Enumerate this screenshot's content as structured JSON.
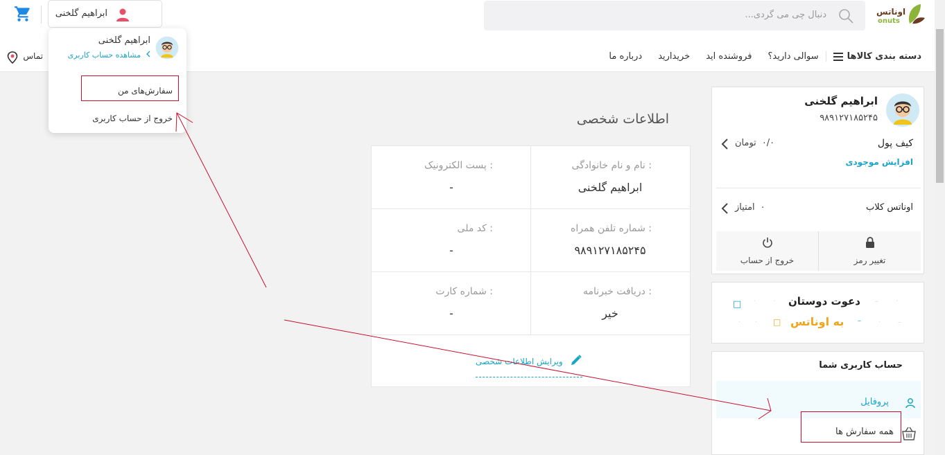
{
  "header": {
    "logo_text": "اوناتس",
    "logo_sub": "onuts",
    "search_placeholder": "دنبال چی می گردی...",
    "user_name": "ابراهیم گلخنی",
    "nav": [
      "دسته بندی کالاها",
      "سوالی دارید؟",
      "فروشنده اید",
      "خریدارید",
      "درباره ما"
    ],
    "contact": "تماس با ما"
  },
  "dropdown": {
    "name": "ابراهیم گلخنی",
    "view_account": "مشاهده حساب کاربری",
    "my_orders": "سفارش‌های من",
    "logout": "خروج از حساب کاربری"
  },
  "main": {
    "title": "اطلاعات شخصی",
    "fields": [
      {
        "label": "نام و نام خانوادگی :",
        "value": "ابراهیم گلخنی"
      },
      {
        "label": "پست الکترونیک :",
        "value": "-"
      },
      {
        "label": "شماره تلفن همراه :",
        "value": "۹۸۹۱۲۷۱۸۵۲۴۵"
      },
      {
        "label": "کد ملی :",
        "value": "-"
      },
      {
        "label": "دریافت خبرنامه :",
        "value": "خیر"
      },
      {
        "label": "شماره کارت :",
        "value": "-"
      }
    ],
    "edit_label": "ویرایش اطلاعات شخصی"
  },
  "sidebar": {
    "name": "ابراهیم گلخنی",
    "phone": "۹۸۹۱۲۷۱۸۵۲۴۵",
    "wallet_label": "کیف پول",
    "wallet_value": "۰/۰",
    "wallet_unit": "تومان",
    "increase": "افزایش موجودی",
    "club_label": "اوناتس کلاب",
    "club_value": "۰",
    "club_unit": "امتیاز",
    "change_password": "تغییر رمز",
    "logout": "خروج از حساب",
    "invite_line1": "دعوت دوستان",
    "invite_line2": "به اوناتس",
    "account_title": "حساب کاربری شما",
    "profile": "پروفایل",
    "all_orders": "همه سفارش ها"
  },
  "colors": {
    "accent": "#1aa4c7",
    "annotation": "#c8102e",
    "invite_orange": "#f0a51b"
  }
}
